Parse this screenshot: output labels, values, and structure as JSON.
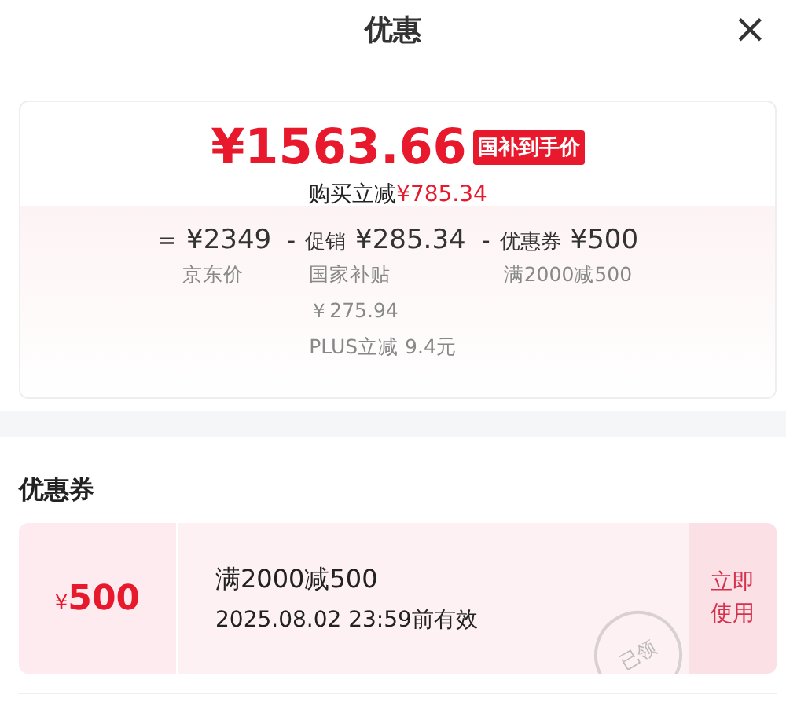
{
  "header": {
    "title": "优惠",
    "close": "×"
  },
  "price": {
    "amount": "¥1563.66",
    "badge": "国补到手价",
    "saving_label": "购买立减",
    "saving_amount": "¥785.34"
  },
  "breakdown": [
    {
      "sign": "=",
      "amount": "¥2349",
      "notes": [
        "京东价"
      ]
    },
    {
      "sign": "-",
      "label": "促销",
      "amount": "¥285.34",
      "notes": [
        "国家补贴",
        "￥275.94",
        "PLUS立减 9.4元"
      ]
    },
    {
      "sign": "-",
      "label": "优惠券",
      "amount": "¥500",
      "notes": [
        "满2000减500"
      ]
    }
  ],
  "coupons_section": {
    "heading": "优惠券",
    "coupons": [
      {
        "currency": "¥",
        "value": "500",
        "title": "满2000减500",
        "validity": "2025.08.02 23:59前有效",
        "stamp": "已领",
        "action": "立即使用"
      }
    ]
  }
}
